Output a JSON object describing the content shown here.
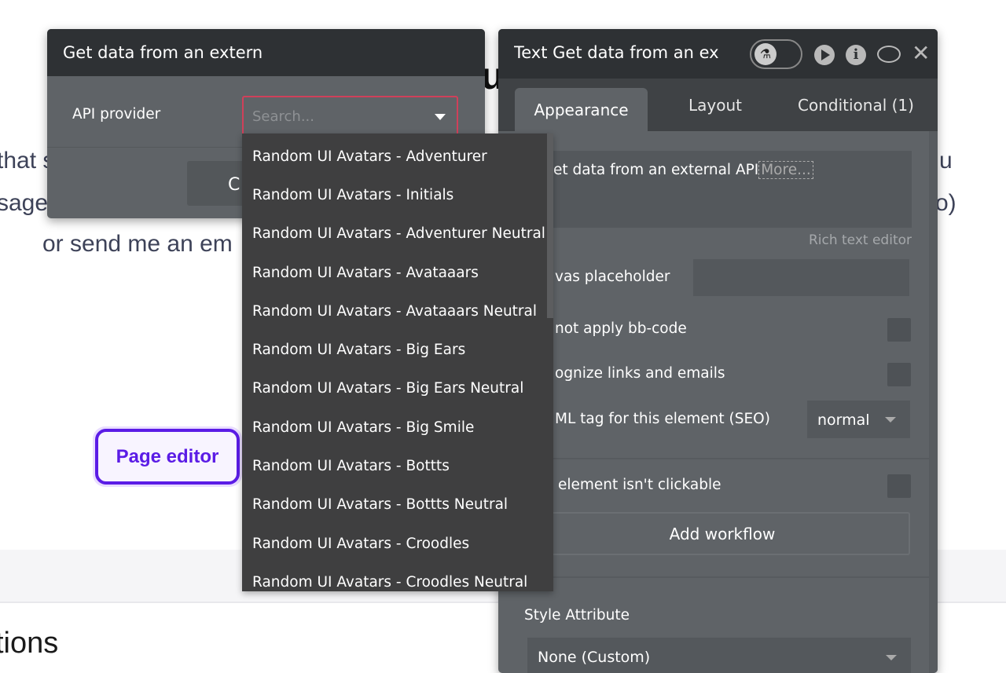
{
  "background": {
    "fragments": [
      "that s",
      "sage",
      "or send me an em",
      "u",
      "o)",
      "tions",
      "us"
    ],
    "page_editor_label": "Page editor"
  },
  "left_panel": {
    "title": "Get data from an extern",
    "api_provider_label": "API provider",
    "search_placeholder": "Search...",
    "button_label": "C",
    "dropdown_options": [
      "Random UI Avatars - Adventurer",
      "Random UI Avatars - Initials",
      "Random UI Avatars - Adventurer Neutral",
      "Random UI Avatars - Avataaars",
      "Random UI Avatars - Avataaars Neutral",
      "Random UI Avatars - Big Ears",
      "Random UI Avatars - Big Ears Neutral",
      "Random UI Avatars - Big Smile",
      "Random UI Avatars - Bottts",
      "Random UI Avatars - Bottts Neutral",
      "Random UI Avatars - Croodles",
      "Random UI Avatars - Croodles Neutral"
    ]
  },
  "right_panel": {
    "title": "Text Get data from an ex",
    "tabs": [
      "Appearance",
      "Layout",
      "Conditional (1)"
    ],
    "active_tab": "Appearance",
    "text_content": "et data from an external API",
    "more_link": "More...",
    "rich_text_label": "Rich text editor",
    "canvas_placeholder_label": "vas placeholder",
    "bbcode_label": "not apply bb-code",
    "links_label": "ognize links and emails",
    "html_tag_label": "ML tag for this element (SEO)",
    "html_tag_value": "normal",
    "not_clickable_label": "element isn't clickable",
    "add_workflow_label": "Add workflow",
    "style_attribute_label": "Style Attribute",
    "style_value": "None (Custom)",
    "icons": [
      "flask-icon",
      "play-icon",
      "info-icon",
      "comment-icon",
      "close-icon"
    ]
  },
  "colors": {
    "accent_purple": "#5b1ce6",
    "error_border": "#d0405a",
    "panel_bg": "#5f6367",
    "header_bg": "#2e3134"
  }
}
